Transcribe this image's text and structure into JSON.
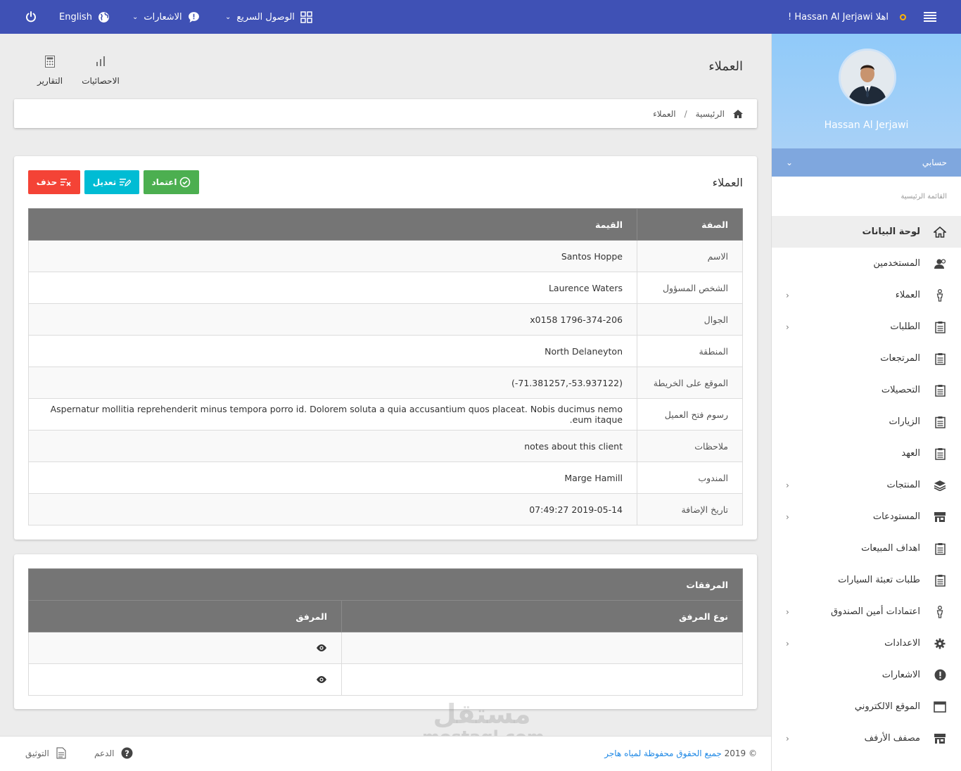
{
  "topbar": {
    "greeting": "اهلا Hassan Al Jerjawi !",
    "quick_access": "الوصول السريع",
    "notifications": "الاشعارات",
    "language": "English"
  },
  "page": {
    "title": "العملاء",
    "quick_buttons": {
      "stats": "الاحصائيات",
      "reports": "التقارير"
    }
  },
  "breadcrumb": {
    "home": "الرئيسية",
    "separator": "/",
    "current": "العملاء"
  },
  "client_card": {
    "title": "العملاء",
    "buttons": {
      "approve": "اعتماد",
      "edit": "تعديل",
      "delete": "حذف"
    },
    "headers": {
      "attribute": "الصفة",
      "value": "القيمة"
    },
    "rows": [
      {
        "key": "الاسم",
        "value": "Santos Hoppe"
      },
      {
        "key": "الشخص المسؤول",
        "value": "Laurence Waters"
      },
      {
        "key": "الجوال",
        "value": "1796-374-206 x0158"
      },
      {
        "key": "المنطقة",
        "value": "North Delaneyton"
      },
      {
        "key": "الموقع على الخريطة",
        "value": "(53.937122-,71.381257-)"
      },
      {
        "key": "رسوم فتح العميل",
        "value": "Aspernatur mollitia reprehenderit minus tempora porro id. Dolorem soluta a quia accusantium quos placeat. Nobis ducimus nemo eum itaque."
      },
      {
        "key": "ملاحظات",
        "value": "notes about this client"
      },
      {
        "key": "المندوب",
        "value": "Marge Hamill"
      },
      {
        "key": "تاريخ الإضافة",
        "value": "2019-05-14 07:49:27"
      }
    ]
  },
  "attachments": {
    "title": "المرفقات",
    "headers": {
      "type": "نوع المرفق",
      "file": "المرفق"
    },
    "rows": [
      {
        "type": "",
        "file_icon": "eye-icon"
      },
      {
        "type": "",
        "file_icon": "eye-icon"
      }
    ]
  },
  "sidebar": {
    "profile_name": "Hassan Al Jerjawi",
    "account": "حسابي",
    "menu_title": "القائمة الرئيسية",
    "items": [
      {
        "label": "لوحة البيانات",
        "icon": "home-icon",
        "chevron": false,
        "active": true
      },
      {
        "label": "المستخدمين",
        "icon": "users-icon",
        "chevron": false
      },
      {
        "label": "العملاء",
        "icon": "person-icon",
        "chevron": true
      },
      {
        "label": "الطلبات",
        "icon": "clipboard-icon",
        "chevron": true
      },
      {
        "label": "المرتجعات",
        "icon": "clipboard-icon",
        "chevron": false
      },
      {
        "label": "التحصيلات",
        "icon": "clipboard-icon",
        "chevron": false
      },
      {
        "label": "الزيارات",
        "icon": "clipboard-icon",
        "chevron": false
      },
      {
        "label": "العهد",
        "icon": "clipboard-icon",
        "chevron": false
      },
      {
        "label": "المنتجات",
        "icon": "layers-icon",
        "chevron": true
      },
      {
        "label": "المستودعات",
        "icon": "store-icon",
        "chevron": true
      },
      {
        "label": "اهداف المبيعات",
        "icon": "clipboard-icon",
        "chevron": false
      },
      {
        "label": "طلبات تعبئة السيارات",
        "icon": "clipboard-icon",
        "chevron": false
      },
      {
        "label": "اعتمادات أمين الصندوق",
        "icon": "person-icon",
        "chevron": true
      },
      {
        "label": "الاعدادات",
        "icon": "gear-icon",
        "chevron": true
      },
      {
        "label": "الاشعارات",
        "icon": "alert-icon",
        "chevron": false
      },
      {
        "label": "الموقع الالكتروني",
        "icon": "browser-icon",
        "chevron": false
      },
      {
        "label": "مصفف الأرفف",
        "icon": "store-icon",
        "chevron": true
      }
    ]
  },
  "footer": {
    "copyright_prefix": "© 2019",
    "copyright_link": "جميع الحقوق محفوظة لمياه هاجر",
    "support": "الدعم",
    "docs": "التوثيق"
  },
  "watermark": {
    "line1": "مستقل",
    "line2": "mostaql.com"
  },
  "colors": {
    "topbar": "#3f51b5",
    "approve": "#4caf50",
    "edit": "#00bcd4",
    "delete": "#f44336",
    "table_header": "#757575",
    "profile_bg": "#90caf9"
  }
}
